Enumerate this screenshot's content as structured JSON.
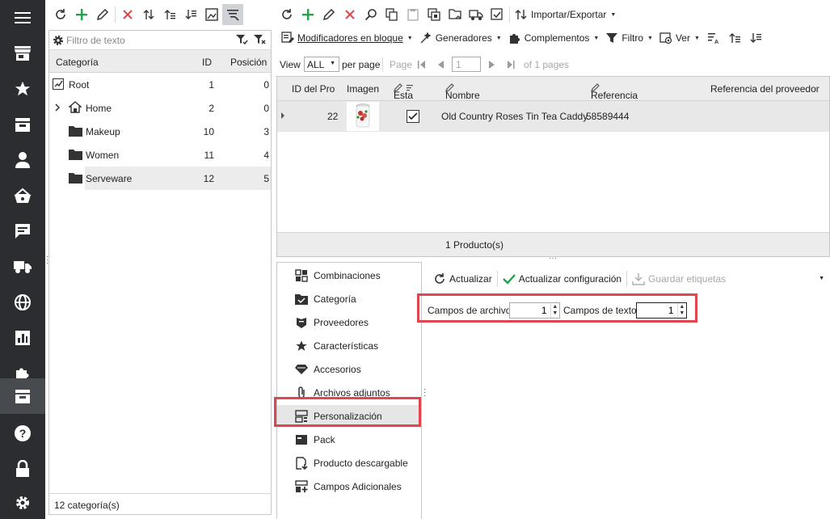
{
  "colors": {
    "sidebar_bg": "#2b2d30",
    "sidebar_active": "#474a4f",
    "green": "#21a54b",
    "red": "#e0464d",
    "highlight": "#e0464d"
  },
  "sidebar": {
    "icons": [
      "menu-icon",
      "store-icon",
      "star-icon",
      "inbox-icon",
      "user-icon",
      "basket-icon",
      "chat-icon",
      "truck-icon",
      "globe-icon",
      "chart-icon",
      "puzzle-icon",
      "catalog-icon",
      "help-icon",
      "lock-icon",
      "gear-icon"
    ],
    "active": "catalog-icon"
  },
  "category_panel": {
    "filter_placeholder": "Filtro de texto",
    "columns": {
      "category": "Categoría",
      "id": "ID",
      "position": "Posición"
    },
    "rows": [
      {
        "name": "Root",
        "id": "1",
        "position": "0"
      },
      {
        "name": "Home",
        "id": "2",
        "position": "0"
      },
      {
        "name": "Makeup",
        "id": "10",
        "position": "3"
      },
      {
        "name": "Women",
        "id": "11",
        "position": "4"
      },
      {
        "name": "Serveware",
        "id": "12",
        "position": "5"
      }
    ],
    "footer": "12 categoría(s)"
  },
  "product_toolbar": {
    "import_export": "Importar/Exportar",
    "bulk_modifiers": "Modificadores en bloque",
    "generators": "Generadores",
    "addons": "Complementos",
    "filter": "Filtro",
    "view": "Ver"
  },
  "pager": {
    "view_label": "View",
    "page_size": "ALL",
    "per_page": "per page",
    "page_label": "Page",
    "page_value": "1",
    "of_pages": "of 1 pages"
  },
  "product_grid": {
    "columns": {
      "id": "ID del Pro",
      "image": "Imagen",
      "status": "Esta",
      "name": "Nombre",
      "reference": "Referencia",
      "supplier_ref": "Referencia del proveedor"
    },
    "rows": [
      {
        "id": "22",
        "name": "Old Country Roses Tin Tea Caddy",
        "reference": "58589444",
        "active": true
      }
    ],
    "footer": "1 Producto(s)"
  },
  "detail_menu": {
    "items": [
      {
        "label": "Combinaciones",
        "icon": "combinations-icon"
      },
      {
        "label": "Categoría",
        "icon": "folder-check-icon"
      },
      {
        "label": "Proveedores",
        "icon": "suppliers-icon"
      },
      {
        "label": "Características",
        "icon": "star-icon"
      },
      {
        "label": "Accesorios",
        "icon": "gem-icon"
      },
      {
        "label": "Archivos adjuntos",
        "icon": "paperclip-icon"
      },
      {
        "label": "Personalización",
        "icon": "customization-icon"
      },
      {
        "label": "Pack",
        "icon": "pack-icon"
      },
      {
        "label": "Producto descargable",
        "icon": "download-file-icon"
      },
      {
        "label": "Campos Adicionales",
        "icon": "add-fields-icon"
      }
    ],
    "selected": "Personalización"
  },
  "customization": {
    "refresh": "Actualizar",
    "update_config": "Actualizar configuración",
    "save_labels": "Guardar etiquetas",
    "file_fields_label": "Campos de archivo",
    "file_fields_value": "1",
    "text_fields_label": "Campos de texto",
    "text_fields_value": "1"
  }
}
